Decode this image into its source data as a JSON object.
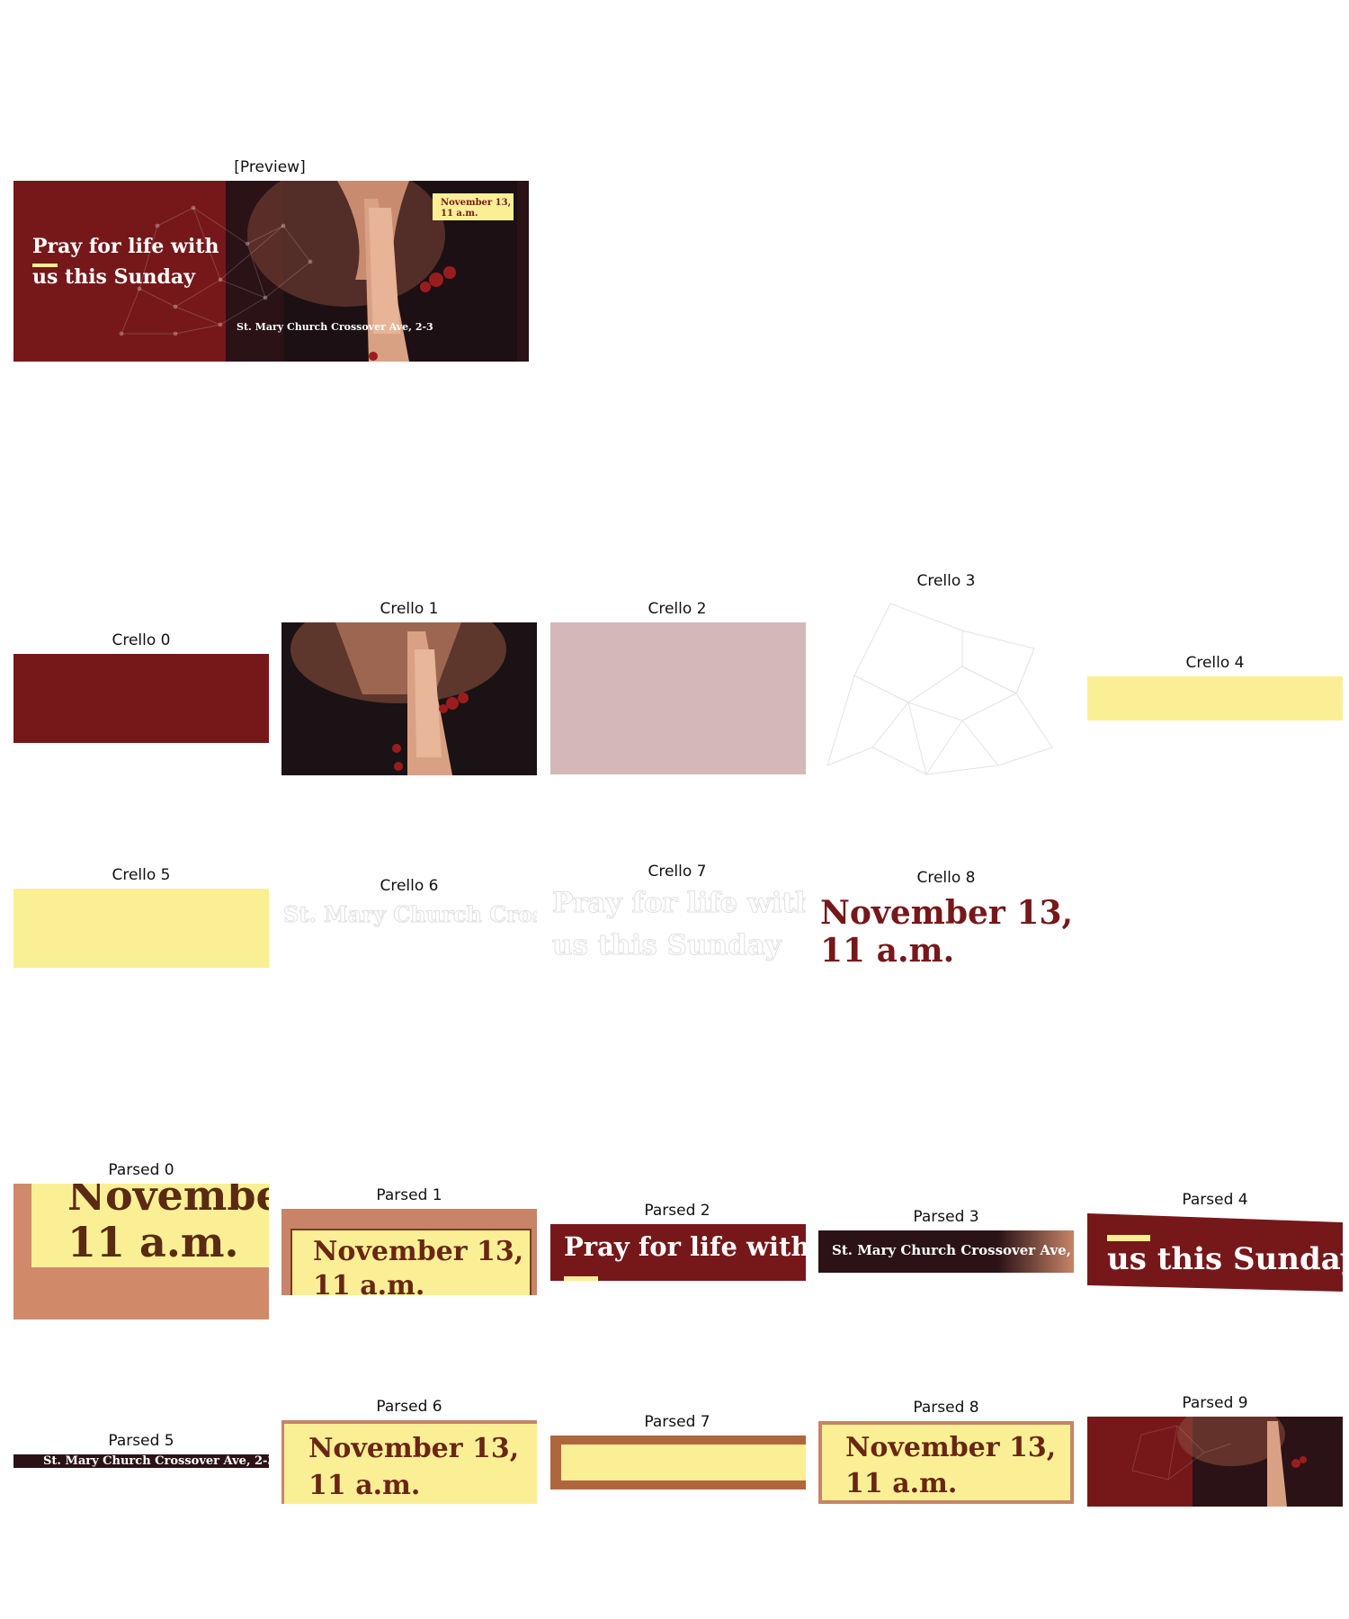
{
  "labels": {
    "preview": "[Preview]",
    "crello": [
      "Crello 0",
      "Crello 1",
      "Crello 2",
      "Crello 3",
      "Crello 4",
      "Crello 5",
      "Crello 6",
      "Crello 7",
      "Crello 8"
    ],
    "parsed": [
      "Parsed 0",
      "Parsed 1",
      "Parsed 2",
      "Parsed 3",
      "Parsed 4",
      "Parsed 5",
      "Parsed 6",
      "Parsed 7",
      "Parsed 8",
      "Parsed 9"
    ]
  },
  "design": {
    "headline_line1": "Pray for life with",
    "headline_line2": "us this Sunday",
    "date_line1": "November 13,",
    "date_line2": "11 a.m.",
    "address": "St. Mary Church Crossover Ave, 2-3"
  },
  "colors": {
    "maroon": "#76181a",
    "dark": "#2a1216",
    "yellow": "#fbef96",
    "pink": "#d4b8b9",
    "skin": "#d08a6a",
    "white": "#ffffff"
  },
  "icons": {
    "photo": "praying-hands-photo",
    "network": "network-lines-graphic"
  }
}
